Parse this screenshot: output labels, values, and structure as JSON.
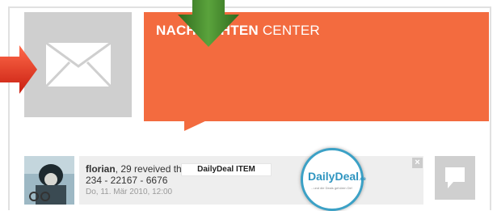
{
  "header": {
    "title_bold": "NACHRICHTEN",
    "title_normal": "CENTER"
  },
  "icons": {
    "mail": "envelope-icon",
    "reply": "speech-bubble-icon",
    "close": "close-icon",
    "pointer_left": "red-arrow-icon",
    "pointer_top": "green-arrow-icon"
  },
  "message": {
    "sender": "florian",
    "text_after_sender": ", 29 reveived the",
    "line2": "234 - 22167 - 6676",
    "date": "Do, 11. Mär 2010, 12:00",
    "badge": "DailyDeal ITEM",
    "close_label": "×"
  },
  "logo": {
    "name": "DailyDeal",
    "suffix": ".de",
    "tagline": "...und die Deals gehören Dir!"
  },
  "colors": {
    "accent_orange": "#f36b3f",
    "icon_tile_gray": "#cfcfcf",
    "arrow_red": "#e8321e",
    "arrow_green": "#3f7f2a",
    "logo_blue": "#3ba1c6"
  }
}
